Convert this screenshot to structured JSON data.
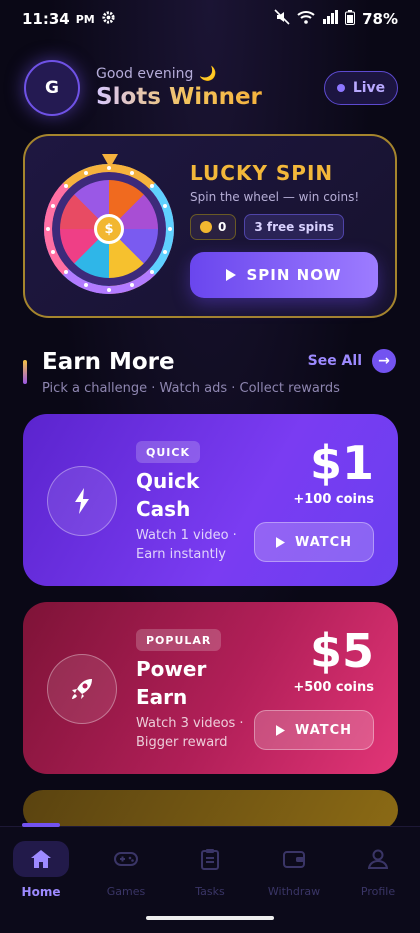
{
  "status_bar": {
    "time": "11:34",
    "ampm": "PM",
    "battery": "78%"
  },
  "header": {
    "avatar_letter": "G",
    "greeting": "Good evening",
    "greeting_emoji": "🌙",
    "title": "Slots Winner",
    "live_label": "Live"
  },
  "lucky_spin": {
    "title": "LUCKY SPIN",
    "subtitle": "Spin the wheel — win coins!",
    "coins": "0",
    "free_spins": "3 free spins",
    "button": "SPIN NOW",
    "hub_symbol": "$"
  },
  "earn_more": {
    "title": "Earn More",
    "subtitle": "Pick a challenge · Watch ads · Collect rewards",
    "see_all": "See All"
  },
  "offers": [
    {
      "tag": "QUICK",
      "title": "Quick Cash",
      "desc": "Watch 1 video · Earn instantly",
      "amount": "$1",
      "coins": "+100 coins",
      "button": "WATCH",
      "icon": "lightning-icon"
    },
    {
      "tag": "POPULAR",
      "title": "Power Earn",
      "desc": "Watch 3 videos · Bigger reward",
      "amount": "$5",
      "coins": "+500 coins",
      "button": "WATCH",
      "icon": "rocket-icon"
    }
  ],
  "nav": [
    {
      "label": "Home",
      "icon": "home-icon",
      "active": true
    },
    {
      "label": "Games",
      "icon": "gamepad-icon"
    },
    {
      "label": "Tasks",
      "icon": "clipboard-icon"
    },
    {
      "label": "Withdraw",
      "icon": "wallet-icon"
    },
    {
      "label": "Profile",
      "icon": "user-icon"
    }
  ],
  "colors": {
    "accent": "#7353f0",
    "gold": "#f3b83a",
    "pink": "#e23577",
    "purple": "#7a3cf2"
  }
}
